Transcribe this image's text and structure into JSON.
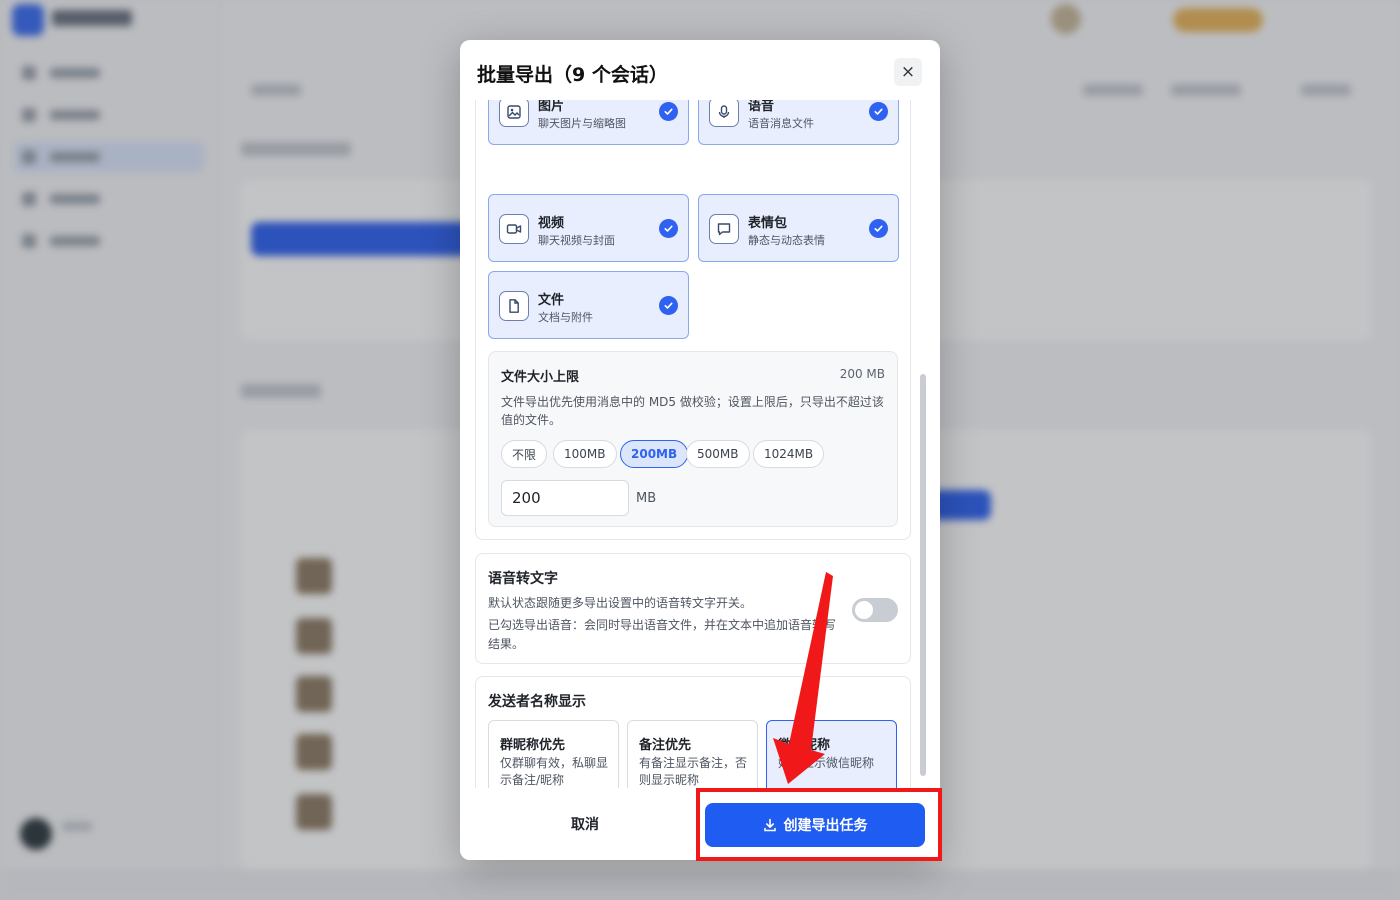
{
  "modal": {
    "title": "批量导出（9 个会话）",
    "close_label": "×"
  },
  "content_types": [
    {
      "name": "图片",
      "desc": "聊天图片与缩略图",
      "icon": "image-icon",
      "checked": true
    },
    {
      "name": "语音",
      "desc": "语音消息文件",
      "icon": "microphone-icon",
      "checked": true
    },
    {
      "name": "视频",
      "desc": "聊天视频与封面",
      "icon": "video-icon",
      "checked": true
    },
    {
      "name": "表情包",
      "desc": "静态与动态表情",
      "icon": "chat-bubble-icon",
      "checked": true
    },
    {
      "name": "文件",
      "desc": "文档与附件",
      "icon": "file-icon",
      "checked": true
    }
  ],
  "file_size": {
    "title": "文件大小上限",
    "current": "200 MB",
    "desc": "文件导出优先使用消息中的 MD5 做校验；设置上限后，只导出不超过该值的文件。",
    "options": [
      "不限",
      "100MB",
      "200MB",
      "500MB",
      "1024MB"
    ],
    "selected": "200MB",
    "input_value": "200",
    "unit": "MB"
  },
  "voice_to_text": {
    "title": "语音转文字",
    "desc1": "默认状态跟随更多导出设置中的语音转文字开关。",
    "desc2": "已勾选导出语音：会同时导出语音文件，并在文本中追加语音转写结果。",
    "enabled": false
  },
  "sender_name": {
    "title": "发送者名称显示",
    "options": [
      {
        "name": "群昵称优先",
        "desc": "仅群聊有效，私聊显示备注/昵称",
        "selected": false
      },
      {
        "name": "备注优先",
        "desc": "有备注显示备注，否则显示昵称",
        "selected": false
      },
      {
        "name": "微信昵称",
        "desc": "始终显示微信昵称",
        "selected": true
      }
    ]
  },
  "footer": {
    "cancel_label": "取消",
    "create_label": "创建导出任务"
  },
  "colors": {
    "accent": "#1f5cf2",
    "annotation": "#f01818"
  }
}
